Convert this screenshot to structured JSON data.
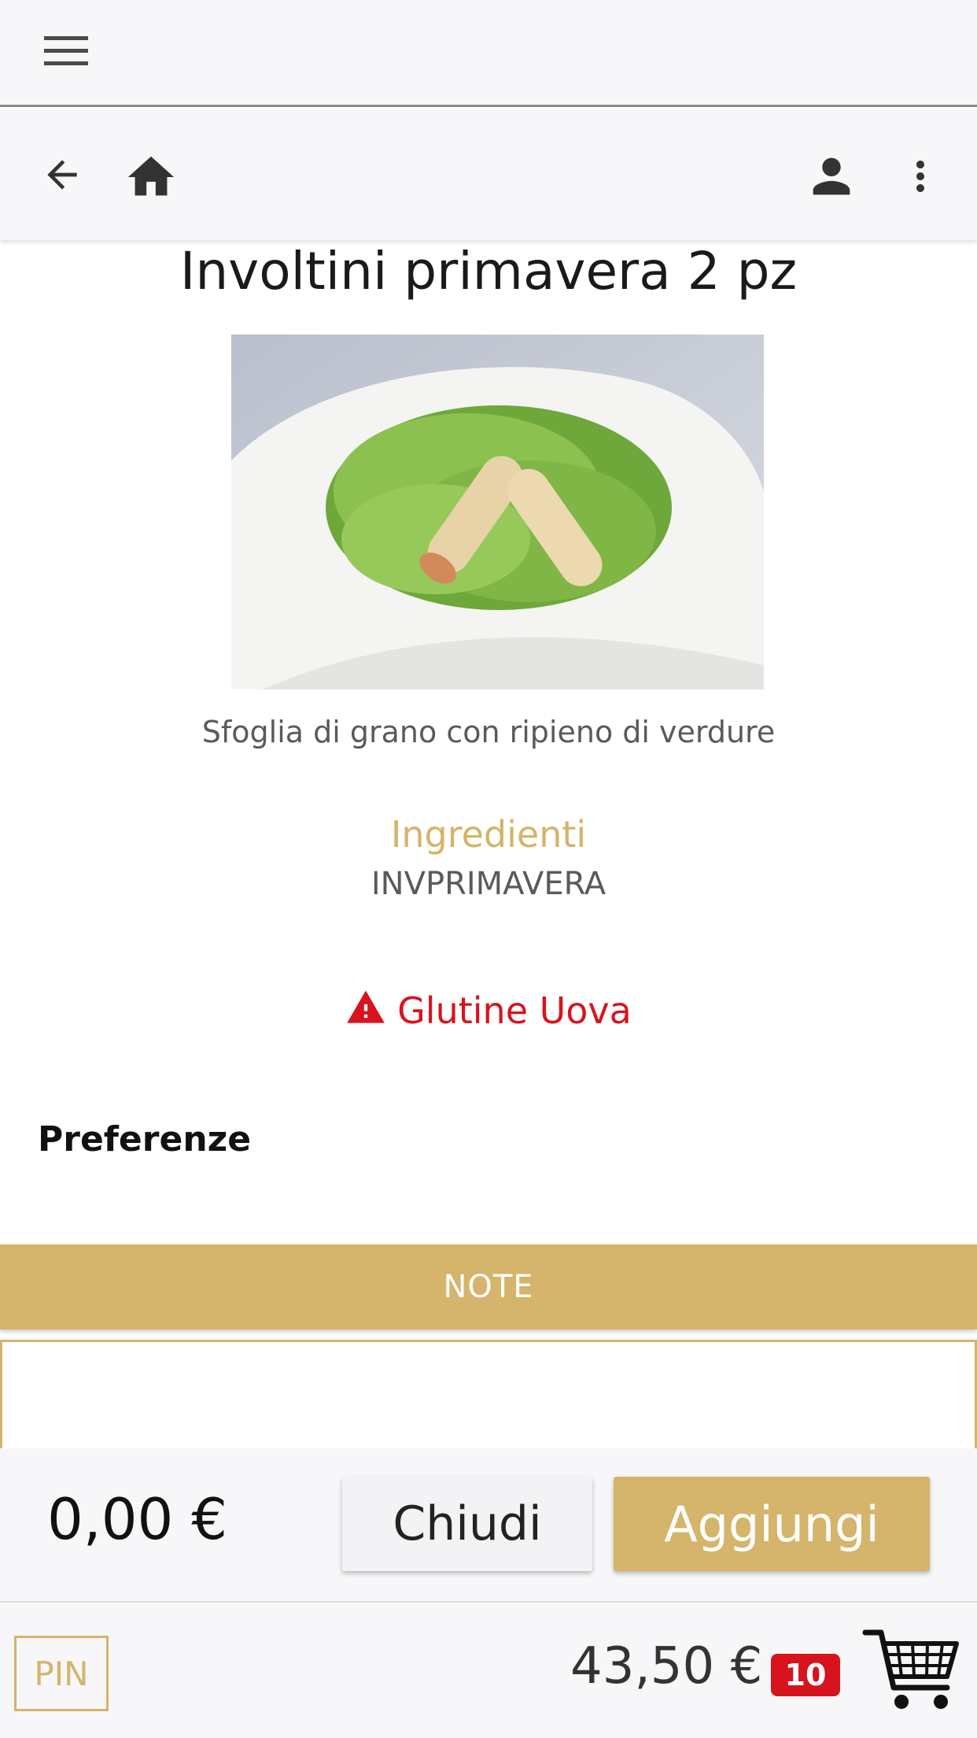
{
  "top_bar": {
    "menu_icon": "hamburger-menu-icon"
  },
  "nav_bar": {
    "back_icon": "arrow-back-icon",
    "home_icon": "home-icon",
    "account_icon": "account-icon",
    "more_icon": "more-vertical-icon"
  },
  "product": {
    "title": "Involtini primavera 2 pz",
    "image_alt": "Involtini primavera on lettuce",
    "description": "Sfoglia di grano con ripieno di verdure",
    "ingredients_label": "Ingredienti",
    "ingredients_code": "INVPRIMAVERA",
    "allergens": "Glutine Uova",
    "allergen_icon": "warning-triangle-icon"
  },
  "preferences_label": "Preferenze",
  "note_label": "NOTE",
  "note_value": "",
  "actions": {
    "price": "0,00 €",
    "close_label": "Chiudi",
    "add_label": "Aggiungi"
  },
  "footer": {
    "pin_label": "PIN",
    "total": "43,50 €",
    "cart_count": "10",
    "cart_icon": "shopping-cart-icon"
  },
  "colors": {
    "accent": "#d5b46b",
    "alert": "#d7141d",
    "bar_bg": "#f7f7f9"
  }
}
